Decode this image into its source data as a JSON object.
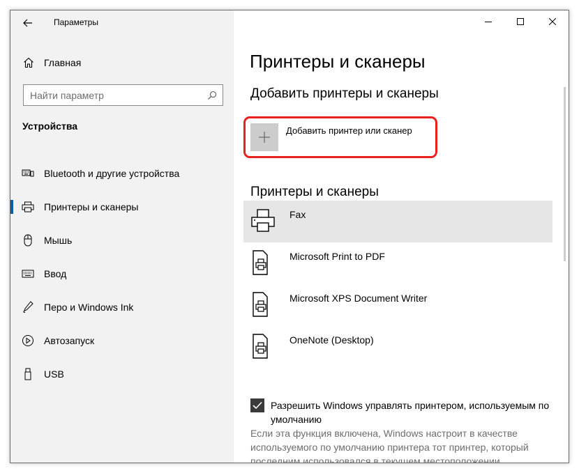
{
  "window": {
    "title": "Параметры",
    "controls": [
      "minimize",
      "maximize",
      "close"
    ]
  },
  "sidebar": {
    "home_label": "Главная",
    "search_placeholder": "Найти параметр",
    "section_title": "Устройства",
    "items": [
      {
        "label": "Bluetooth и другие устройства",
        "icon": "bluetooth-devices-icon",
        "active": false
      },
      {
        "label": "Принтеры и сканеры",
        "icon": "printer-icon",
        "active": true
      },
      {
        "label": "Мышь",
        "icon": "mouse-icon",
        "active": false
      },
      {
        "label": "Ввод",
        "icon": "keyboard-icon",
        "active": false
      },
      {
        "label": "Перо и Windows Ink",
        "icon": "pen-icon",
        "active": false
      },
      {
        "label": "Автозапуск",
        "icon": "autoplay-icon",
        "active": false
      },
      {
        "label": "USB",
        "icon": "usb-icon",
        "active": false
      }
    ]
  },
  "main": {
    "page_title": "Принтеры и сканеры",
    "add_section_heading": "Добавить принтеры и сканеры",
    "add_button_label": "Добавить принтер или сканер",
    "printers_heading": "Принтеры и сканеры",
    "printers": [
      {
        "name": "Fax",
        "selected": true
      },
      {
        "name": "Microsoft Print to PDF",
        "selected": false
      },
      {
        "name": "Microsoft XPS Document Writer",
        "selected": false
      },
      {
        "name": "OneNote (Desktop)",
        "selected": false
      }
    ],
    "checkbox_label": "Разрешить Windows управлять принтером, используемым по умолчанию",
    "checkbox_checked": true,
    "description": "Если эта функция включена, Windows настроит в качестве используемого по умолчанию принтера тот принтер, который последним использовался в текущем местоположении."
  },
  "colors": {
    "accent": "#0a5ea8",
    "highlight_border": "#e8211d",
    "sidebar_bg": "#f2f2f2",
    "selected_row_bg": "#e6e6e6"
  }
}
